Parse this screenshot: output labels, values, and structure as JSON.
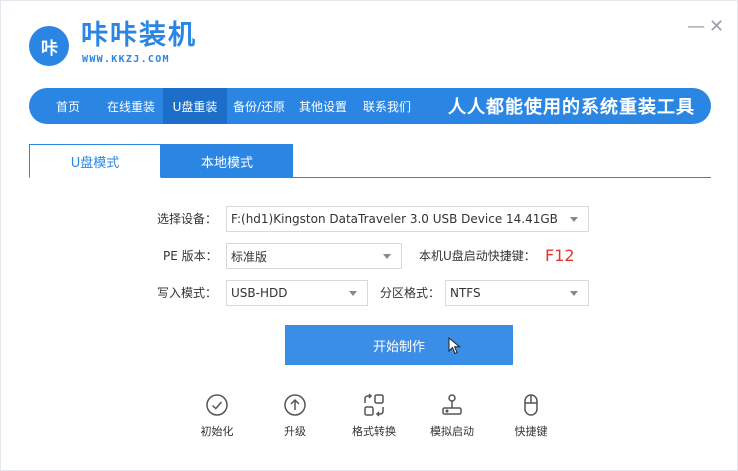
{
  "app": {
    "logo_text": "咔",
    "title": "咔咔装机",
    "url": "WWW.KKZJ.COM",
    "window_controls": {
      "minimize": "—",
      "close": "✕"
    }
  },
  "nav": {
    "items": [
      {
        "label": "首页"
      },
      {
        "label": "在线重装"
      },
      {
        "label": "U盘重装"
      },
      {
        "label": "备份/还原"
      },
      {
        "label": "其他设置"
      },
      {
        "label": "联系我们"
      }
    ],
    "active_index": 2,
    "slogan": "人人都能使用的系统重装工具"
  },
  "tabs": [
    {
      "label": "U盘模式",
      "active": true
    },
    {
      "label": "本地模式",
      "active": false
    }
  ],
  "form": {
    "device": {
      "label": "选择设备：",
      "value": "F:(hd1)Kingston DataTraveler 3.0 USB Device 14.41GB"
    },
    "pe_version": {
      "label": "PE 版本：",
      "value": "标准版"
    },
    "hotkey": {
      "label": "本机U盘启动快捷键：",
      "value": "F12"
    },
    "write_mode": {
      "label": "写入模式：",
      "value": "USB-HDD"
    },
    "partition_format": {
      "label": "分区格式：",
      "value": "NTFS"
    }
  },
  "start_button": {
    "label": "开始制作"
  },
  "tools": [
    {
      "label": "初始化",
      "icon": "check-circle-icon"
    },
    {
      "label": "升级",
      "icon": "upload-circle-icon"
    },
    {
      "label": "格式转换",
      "icon": "convert-icon"
    },
    {
      "label": "模拟启动",
      "icon": "joystick-icon"
    },
    {
      "label": "快捷键",
      "icon": "mouse-icon"
    }
  ],
  "colors": {
    "brand": "#2a86e2",
    "brand_dark": "#1c6ec9",
    "button": "#3a8ee6",
    "hotkey": "#e8322b"
  }
}
